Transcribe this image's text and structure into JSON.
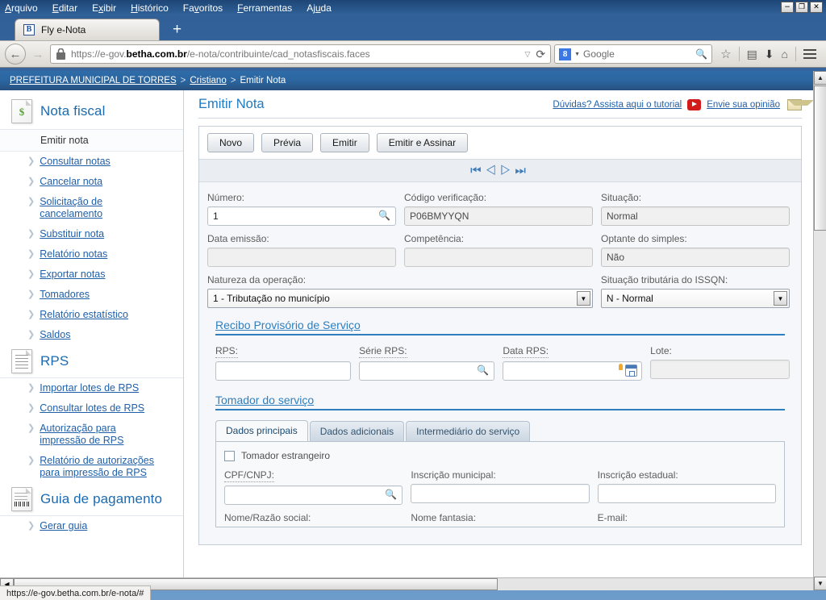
{
  "browser": {
    "menu": [
      "Arquivo",
      "Editar",
      "Exibir",
      "Histórico",
      "Favoritos",
      "Ferramentas",
      "Ajuda"
    ],
    "window_controls": {
      "minimize": "−",
      "restore": "❐",
      "close": "✕"
    },
    "tab_title": "Fly e-Nota",
    "tab_favicon_letter": "B",
    "new_tab_label": "+",
    "url_prefix": "https://e-gov.",
    "url_domain": "betha.com.br",
    "url_suffix": "/e-nota/contribuinte/cad_notasfiscais.faces",
    "search_engine": "Google",
    "search_placeholder": "Google",
    "status_url": "https://e-gov.betha.com.br/e-nota/#"
  },
  "breadcrumb": {
    "root": "PREFEITURA MUNICIPAL DE TORRES",
    "sep": ">",
    "user": "Cristiano",
    "current": "Emitir Nota"
  },
  "sidebar": {
    "groups": [
      {
        "title": "Nota fiscal",
        "icon": "nota-fiscal-icon",
        "current": "Emitir nota",
        "items": [
          "Consultar notas",
          "Cancelar nota",
          "Solicitação de cancelamento",
          "Substituir nota",
          "Relatório notas",
          "Exportar notas",
          "Tomadores",
          "Relatório estatístico",
          "Saldos"
        ]
      },
      {
        "title": "RPS",
        "icon": "rps-icon",
        "items": [
          "Importar lotes de RPS",
          "Consultar lotes de RPS",
          "Autorização para impressão de RPS",
          "Relatório de autorizações para impressão de RPS"
        ]
      },
      {
        "title": "Guia de pagamento",
        "icon": "guia-icon",
        "items": [
          "Gerar guia"
        ]
      }
    ]
  },
  "header": {
    "title": "Emitir Nota",
    "tutorial_link": "Dúvidas? Assista aqui o tutorial",
    "feedback_link": "Envie sua opinião"
  },
  "toolbar": {
    "buttons": [
      "Novo",
      "Prévia",
      "Emitir",
      "Emitir e Assinar"
    ]
  },
  "pager": {
    "first": "⏮",
    "prev": "◁",
    "next": "▷",
    "last": "⏭"
  },
  "form": {
    "numero": {
      "label": "Número:",
      "value": "1"
    },
    "codigo_verificacao": {
      "label": "Código verificação:",
      "value": "P06BMYYQN"
    },
    "situacao": {
      "label": "Situação:",
      "value": "Normal"
    },
    "data_emissao": {
      "label": "Data emissão:",
      "value": ""
    },
    "competencia": {
      "label": "Competência:",
      "value": ""
    },
    "optante_simples": {
      "label": "Optante do simples:",
      "value": "Não"
    },
    "natureza_operacao": {
      "label": "Natureza da operação:",
      "value": "1 - Tributação no município"
    },
    "situacao_tributaria": {
      "label": "Situação tributária do ISSQN:",
      "value": "N - Normal"
    }
  },
  "rps_section": {
    "title": "Recibo Provisório de Serviço",
    "rps": {
      "label": "RPS:",
      "value": ""
    },
    "serie_rps": {
      "label": "Série RPS:",
      "value": ""
    },
    "data_rps": {
      "label": "Data RPS:",
      "value": ""
    },
    "lote": {
      "label": "Lote:",
      "value": ""
    }
  },
  "tomador_section": {
    "title": "Tomador do serviço",
    "tabs": [
      "Dados principais",
      "Dados adicionais",
      "Intermediário do serviço"
    ],
    "active_tab": "Dados principais",
    "checkbox_label": "Tomador estrangeiro",
    "checkbox_checked": false,
    "cpf_cnpj": {
      "label": "CPF/CNPJ:",
      "value": ""
    },
    "inscricao_municipal": {
      "label": "Inscrição municipal:",
      "value": ""
    },
    "inscricao_estadual": {
      "label": "Inscrição estadual:",
      "value": ""
    },
    "nome_razao": {
      "label": "Nome/Razão social:"
    },
    "nome_fantasia": {
      "label": "Nome fantasia:"
    },
    "email": {
      "label": "E-mail:"
    }
  },
  "colors": {
    "accent_blue": "#2f7fbf",
    "link_blue": "#1f5fa8",
    "crumb_bar": "#2b66a0",
    "panel_bg": "#f5f7fa"
  }
}
